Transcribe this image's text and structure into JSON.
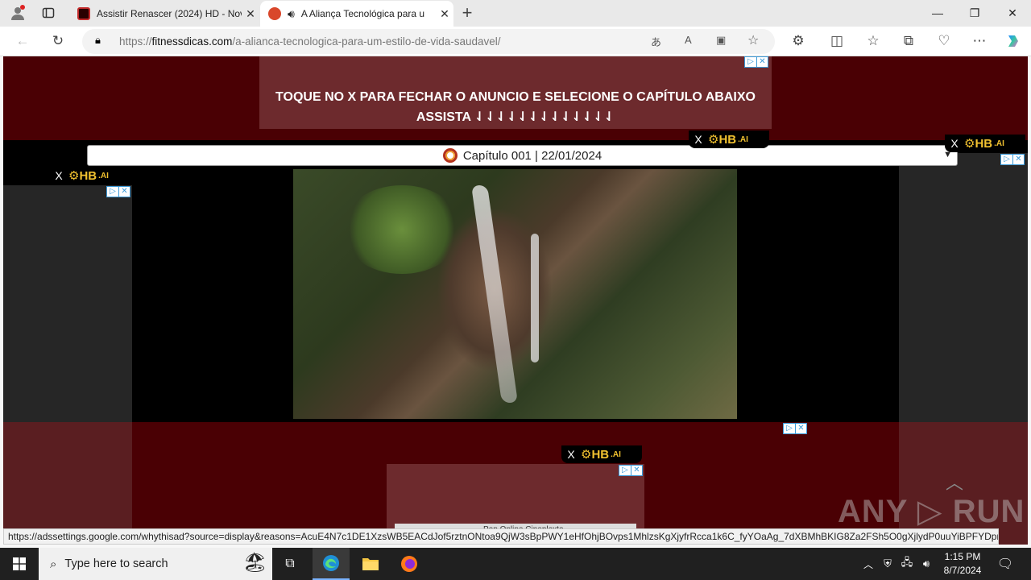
{
  "browser": {
    "tabs": [
      {
        "title": "Assistir Renascer (2024) HD - Nov",
        "active": false,
        "favicon_color": "#c22a2a"
      },
      {
        "title": "A Aliança Tecnológica para u",
        "active": true,
        "favicon_color": "#d9472b"
      }
    ],
    "new_tab_symbol": "+",
    "url_prefix": "https://",
    "url_domain": "fitnessdicas.com",
    "url_path": "/a-alianca-tecnologica-para-um-estilo-de-vida-saudavel/"
  },
  "page": {
    "top_ad_line1": "TOQUE NO X PARA FECHAR O ANUNCIO E SELECIONE O CAPÍTULO ABAIXO",
    "top_ad_line2": "ASSISTA ⇃⇃⇃⇃⇃⇃⇃⇃⇃⇃⇃⇃⇃",
    "chapter_select": "Capítulo 001 | 22/01/2024",
    "hb_brand": "HB",
    "hb_suffix": ".AI",
    "hb_close": "X",
    "bottom_ad_text": "Pop Online Cineplexte",
    "watermark": "ANY ▷ RUN"
  },
  "status_url": "https://adssettings.google.com/whythisad?source=display&reasons=AcuE4N7c1DE1XzsWB5EACdJof5rztnONtoa9QjW3sBpPWY1eHfOhjBOvps1MhlzsKgXjyfrRcca1k6C_fyYOaAg_7dXBMhBKIG8Za2FSh5O0gXjlydP0uuYiBPFYDpmEVcer...",
  "taskbar": {
    "search_placeholder": "Type here to search",
    "time": "1:15 PM",
    "date": "8/7/2024"
  },
  "colors": {
    "page_bg": "#4a0004",
    "ad_bg": "#6d2a2d",
    "hb_gold": "#f2c230"
  }
}
